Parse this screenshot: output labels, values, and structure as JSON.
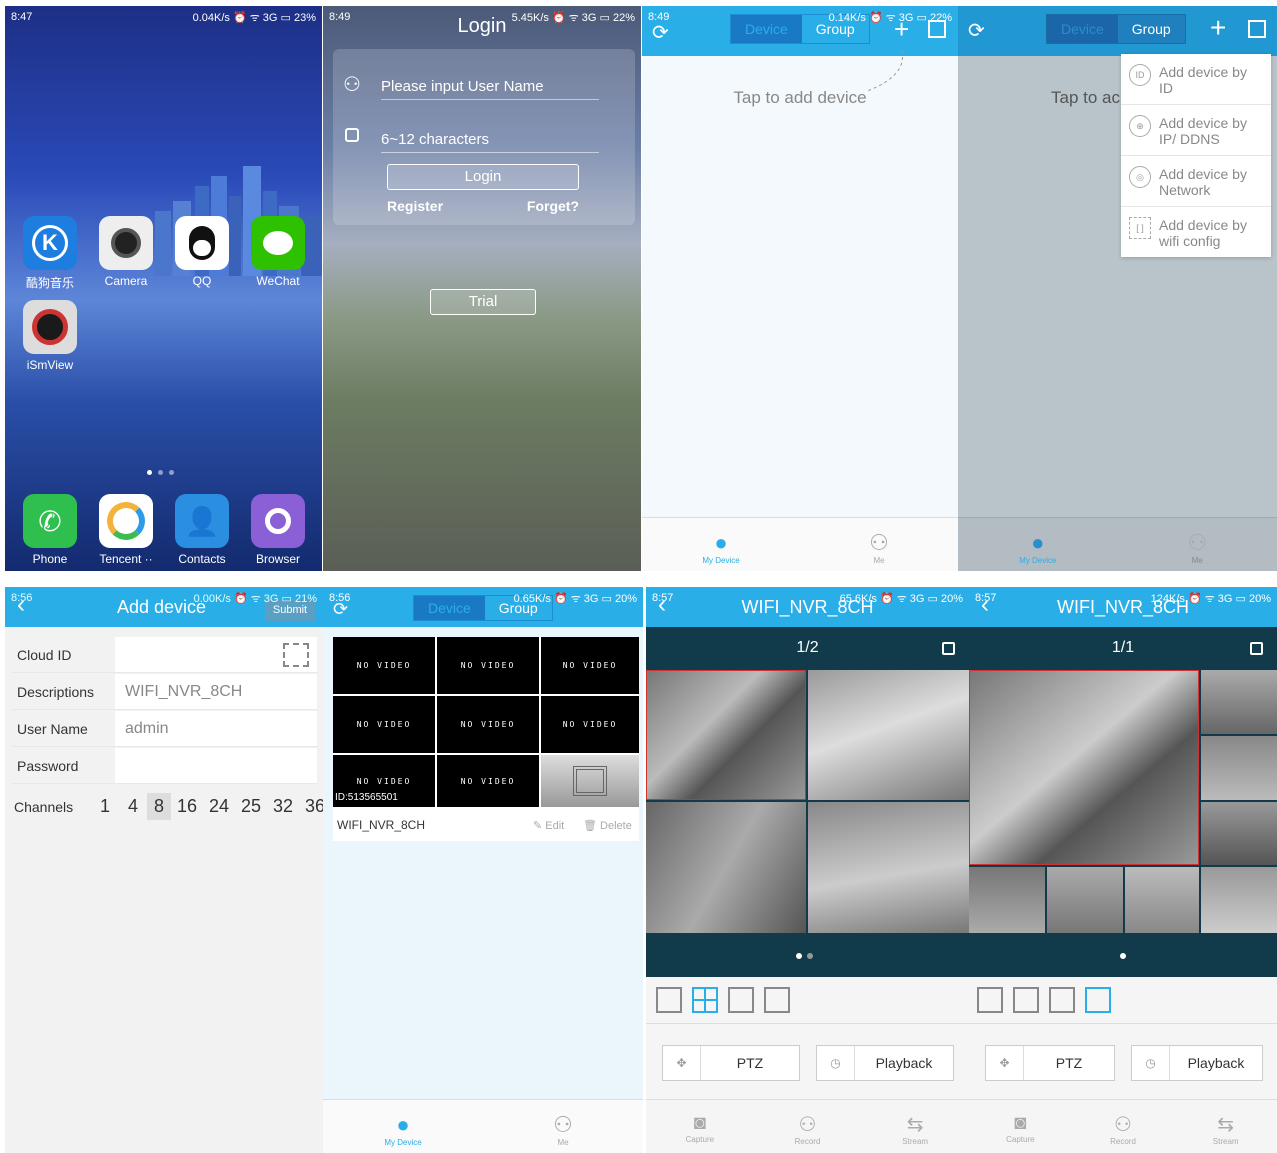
{
  "s1": {
    "status": {
      "time": "8:47",
      "right": "0.04K/s ⏰ ᯤ 3G ▭ 23%"
    },
    "apps": [
      {
        "label": "酷狗音乐",
        "icon": "kugou-icon"
      },
      {
        "label": "Camera",
        "icon": "camera-icon"
      },
      {
        "label": "QQ",
        "icon": "qq-icon"
      },
      {
        "label": "WeChat",
        "icon": "wechat-icon"
      },
      {
        "label": "iSmView",
        "icon": "ismview-icon"
      }
    ],
    "dock": [
      {
        "label": "Phone"
      },
      {
        "label": "Tencent ··"
      },
      {
        "label": "Contacts"
      },
      {
        "label": "Browser"
      }
    ]
  },
  "s2": {
    "status": {
      "time": "8:49",
      "right": "5.45K/s ⏰ ᯤ 3G ▭ 22%"
    },
    "title": "Login",
    "user_placeholder": "Please input User Name",
    "pass_placeholder": "6~12 characters",
    "login": "Login",
    "register": "Register",
    "forget": "Forget?",
    "trial": "Trial"
  },
  "s3": {
    "status": {
      "time": "8:49",
      "right": "0.14K/s ⏰ ᯤ 3G ▭ 22%"
    },
    "seg": [
      "Device",
      "Group"
    ],
    "hint": "Tap to add device",
    "tabs": [
      "My Device",
      "Me"
    ]
  },
  "s4": {
    "seg": [
      "Device",
      "Group"
    ],
    "hint": "Tap to ac",
    "menu": [
      "Add device by ID",
      "Add device by IP/ DDNS",
      "Add device by Network",
      "Add device by wifi config"
    ],
    "menu_icons": [
      "ID",
      "⊕",
      "◎",
      "[ ]"
    ],
    "tabs": [
      "My Device",
      "Me"
    ]
  },
  "s5": {
    "status": {
      "time": "8:56",
      "right": "0.00K/s ⏰ ᯤ 3G ▭ 21%"
    },
    "title": "Add device",
    "submit": "Submit",
    "rows": [
      {
        "label": "Cloud ID",
        "value": ""
      },
      {
        "label": "Descriptions",
        "value": "WIFI_NVR_8CH"
      },
      {
        "label": "User Name",
        "value": "admin"
      },
      {
        "label": "Password",
        "value": ""
      }
    ],
    "channels_label": "Channels",
    "channels": [
      "1",
      "4",
      "8",
      "16",
      "24",
      "25",
      "32",
      "36"
    ]
  },
  "s6": {
    "status": {
      "time": "8:56",
      "right": "0.65K/s ⏰ ᯤ 3G ▭ 20%"
    },
    "seg": [
      "Device",
      "Group"
    ],
    "novideo": "NO VIDEO",
    "id": "ID:513565501",
    "name": "WIFI_NVR_8CH",
    "edit": "Edit",
    "delete": "Delete",
    "tabs": [
      "My Device",
      "Me"
    ]
  },
  "s7": {
    "status": {
      "time": "8:57",
      "right": "65.6K/s ⏰ ᯤ 3G ▭ 20%"
    },
    "title": "WIFI_NVR_8CH",
    "page": "1/2",
    "ptz": "PTZ",
    "playback": "Playback",
    "bottom": [
      "Capture",
      "Record",
      "Stream"
    ]
  },
  "s8": {
    "status": {
      "time": "8:57",
      "right": "124K/s ⏰ ᯤ 3G ▭ 20%"
    },
    "title": "WIFI_NVR_8CH",
    "page": "1/1",
    "ptz": "PTZ",
    "playback": "Playback",
    "bottom": [
      "Capture",
      "Record",
      "Stream"
    ]
  },
  "colors": {
    "accent": "#2aaee8",
    "accent_dark": "#1a79c4",
    "novideo_bg": "#000000"
  }
}
